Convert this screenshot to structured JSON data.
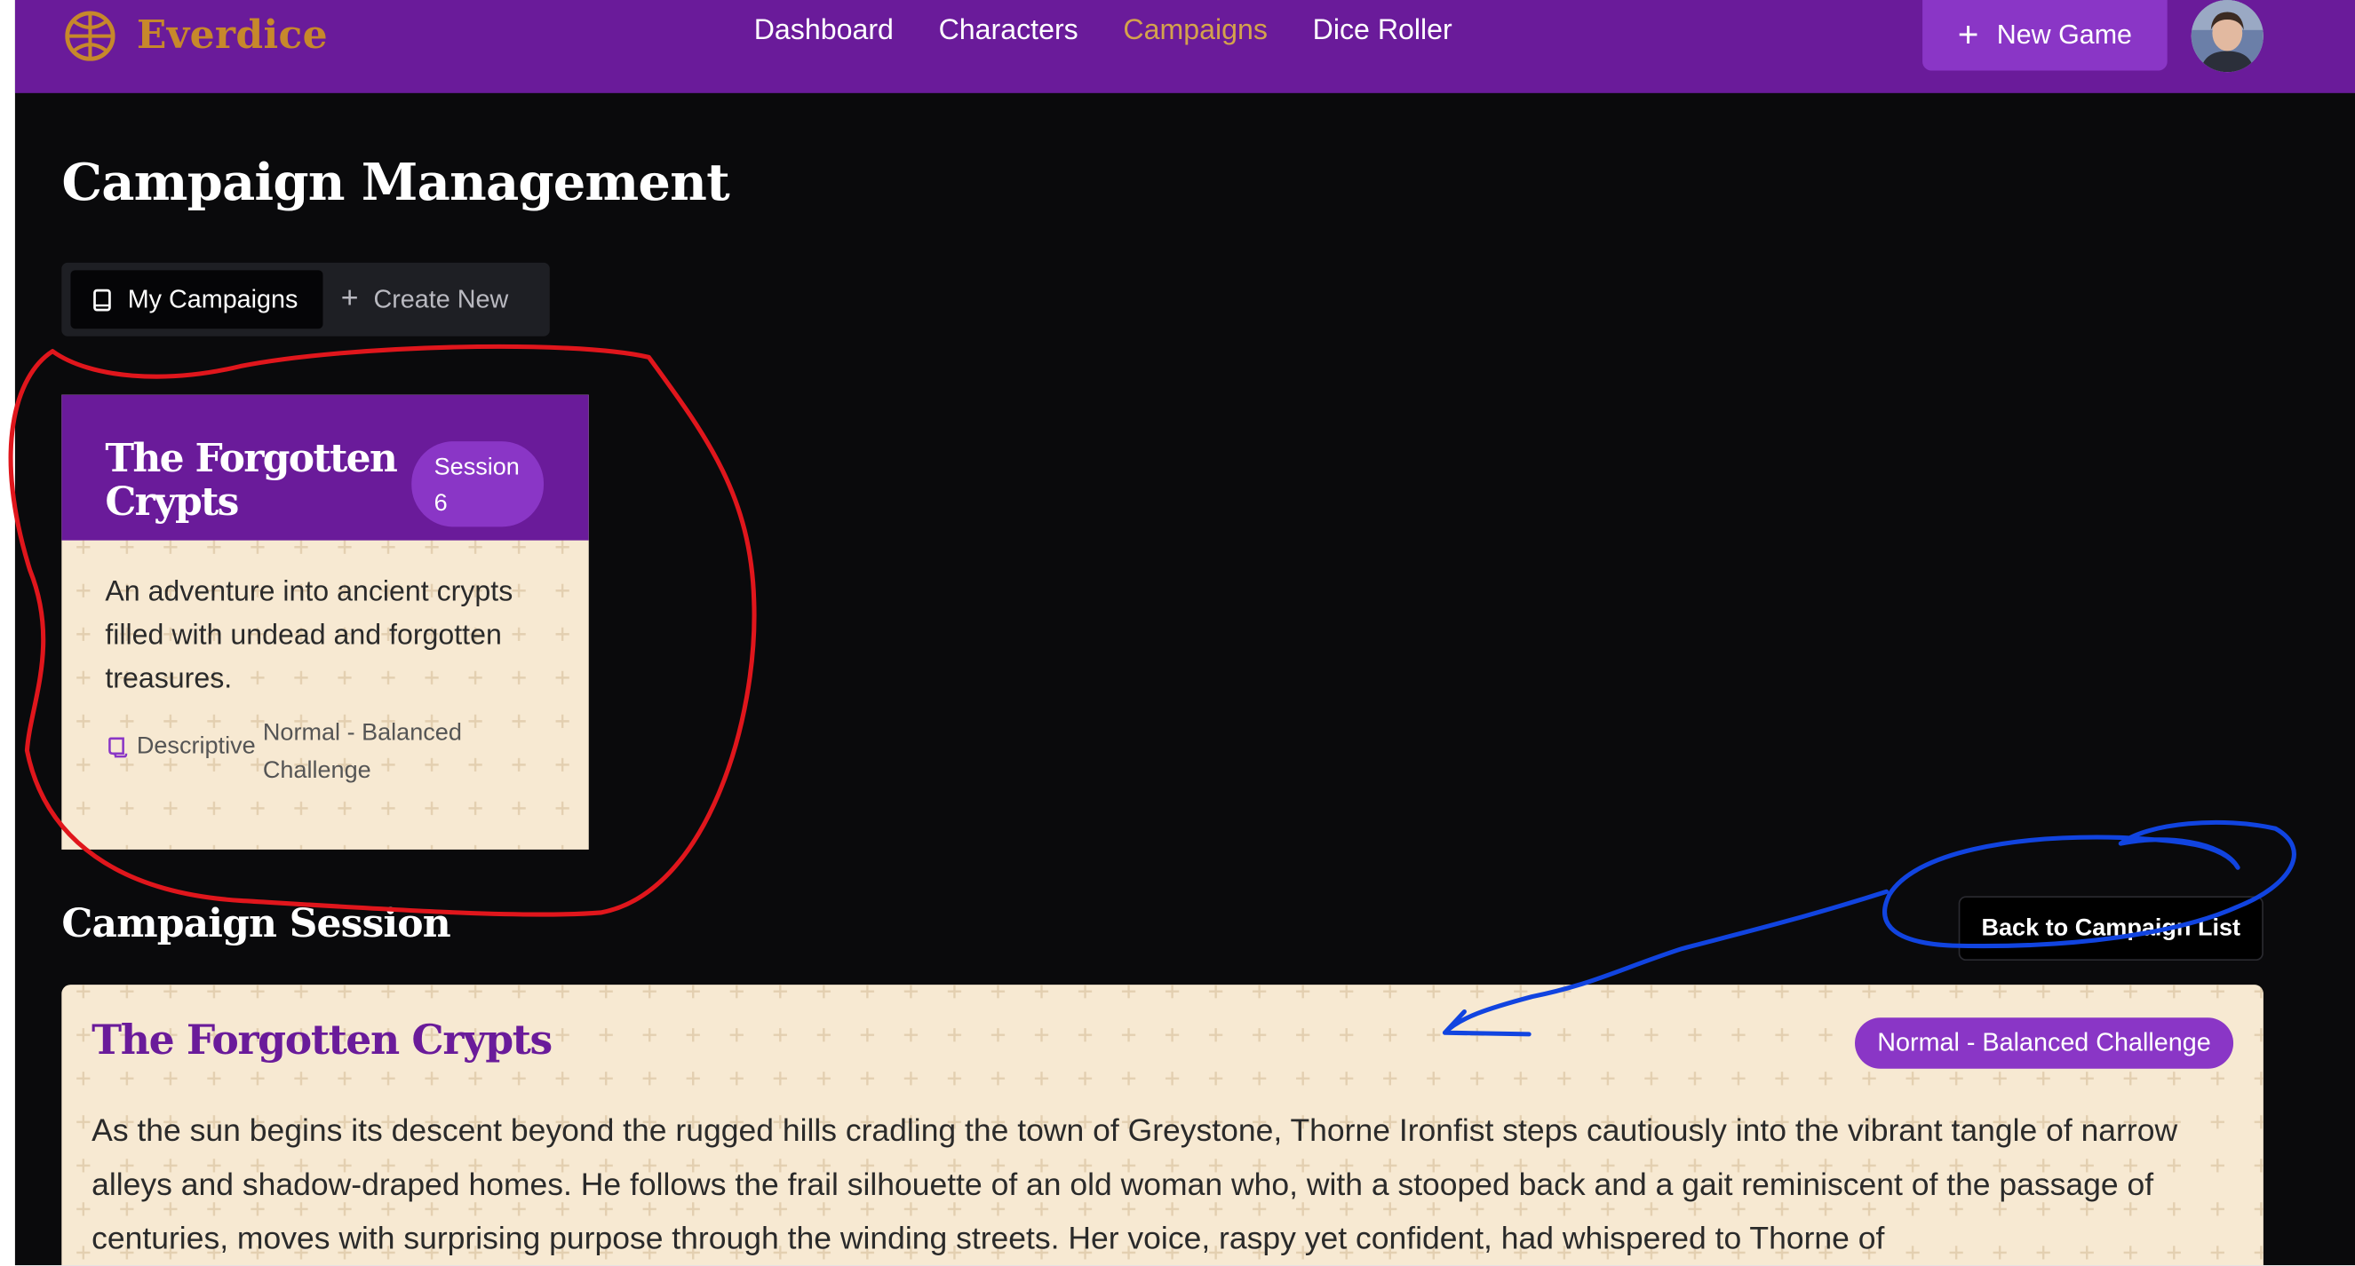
{
  "brand": {
    "name": "Everdice",
    "logo_icon": "compass-globe-icon",
    "color": "#c7882b"
  },
  "nav": {
    "links": [
      {
        "label": "Dashboard",
        "active": false
      },
      {
        "label": "Characters",
        "active": false
      },
      {
        "label": "Campaigns",
        "active": true
      },
      {
        "label": "Dice Roller",
        "active": false
      }
    ],
    "new_game_label": "New Game",
    "new_game_icon": "plus-icon",
    "avatar_icon": "user-avatar"
  },
  "page": {
    "title": "Campaign Management"
  },
  "tabs": [
    {
      "label": "My Campaigns",
      "icon": "book-icon",
      "active": true
    },
    {
      "label": "Create New",
      "icon": "plus-icon",
      "active": false
    }
  ],
  "campaign_card": {
    "title": "The Forgotten Crypts",
    "session_label": "Session",
    "session_number": "6",
    "description": "An adventure into ancient crypts filled with undead and forgotten treasures.",
    "style_label": "Descriptive",
    "style_icon": "scroll-icon",
    "difficulty": "Normal - Balanced Challenge"
  },
  "session_section": {
    "title": "Campaign Session",
    "back_label": "Back to Campaign List"
  },
  "session_panel": {
    "title": "The Forgotten Crypts",
    "difficulty": "Normal - Balanced Challenge",
    "narrative": "As the sun begins its descent beyond the rugged hills cradling the town of Greystone, Thorne Ironfist steps cautiously into the vibrant tangle of narrow alleys and shadow-draped homes. He follows the frail silhouette of an old woman who, with a stooped back and a gait reminiscent of the passage of centuries, moves with surprising purpose through the winding streets. Her voice, raspy yet confident, had whispered to Thorne of"
  },
  "colors": {
    "navbar": "#6a1b9a",
    "accent": "#8a36c6",
    "active_link": "#d4a24c",
    "parchment": "#f7e9d2",
    "background": "#0a0a0c",
    "annotation_red": "#e0161c",
    "annotation_blue": "#1144e0"
  }
}
